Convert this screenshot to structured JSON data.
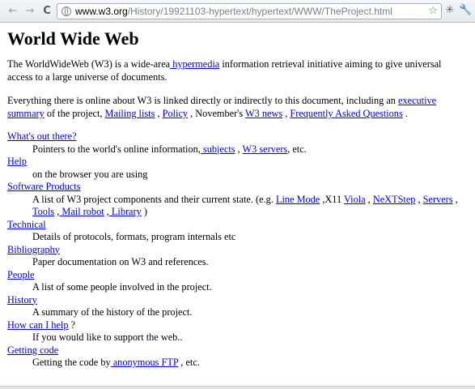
{
  "browser": {
    "url_host": "www.w3.org",
    "url_path": "/History/19921103-hypertext/hypertext/WWW/TheProject.html",
    "back_icon": "←",
    "forward_icon": "→",
    "reload_icon": "C",
    "star_icon": "☆",
    "puzzle_icon": "✳",
    "wrench_icon": "🔧"
  },
  "page": {
    "title": "World Wide Web",
    "intro": {
      "text1": "The WorldWideWeb (W3) is a wide-area",
      "link1": " hypermedia",
      "text2": " information retrieval initiative aiming to give universal access to a large universe of documents."
    },
    "para2": {
      "t1": "Everything there is online about W3 is linked directly or indirectly to this document, including an ",
      "l1": "executive summary",
      "t2": " of the project, ",
      "l2": "Mailing lists",
      "t3": " , ",
      "l3": "Policy",
      "t4": " , November's ",
      "l4": "W3 news",
      "t5": " , ",
      "l5": "Frequently Asked Questions",
      "t6": " ."
    },
    "whats_out": {
      "term": "What's out there?",
      "d1": "Pointers to the world's online information,",
      "l1": " subjects",
      "d2": " , ",
      "l2": "W3 servers",
      "d3": ", etc."
    },
    "help": {
      "term": "Help",
      "desc": "on the browser you are using"
    },
    "software": {
      "term": "Software Products",
      "d1": "A list of W3 project components and their current state. (e.g. ",
      "l1": "Line Mode",
      "d2": " ,X11 ",
      "l2": "Viola",
      "d3": " , ",
      "l3": "NeXTStep",
      "d4": " , ",
      "l4": "Servers",
      "d5": " , ",
      "l5": "Tools",
      "d6": " ,",
      "l6": " Mail robot",
      "d7": " ,",
      "l7": " Library",
      "d8": " )"
    },
    "technical": {
      "term": "Technical",
      "desc": "Details of protocols, formats, program internals etc"
    },
    "bibliography": {
      "term": "Bibliography",
      "desc": "Paper documentation on W3 and references."
    },
    "people": {
      "term": "People",
      "desc": "A list of some people involved in the project."
    },
    "history": {
      "term": "History",
      "desc": "A summary of the history of the project."
    },
    "howcanihelp": {
      "term": "How can I help",
      "suffix": " ?",
      "desc": "If you would like to support the web.."
    },
    "gettingcode": {
      "term": "Getting code",
      "d1": "Getting the code by",
      "l1": " anonymous FTP",
      "d2": " , etc."
    }
  }
}
